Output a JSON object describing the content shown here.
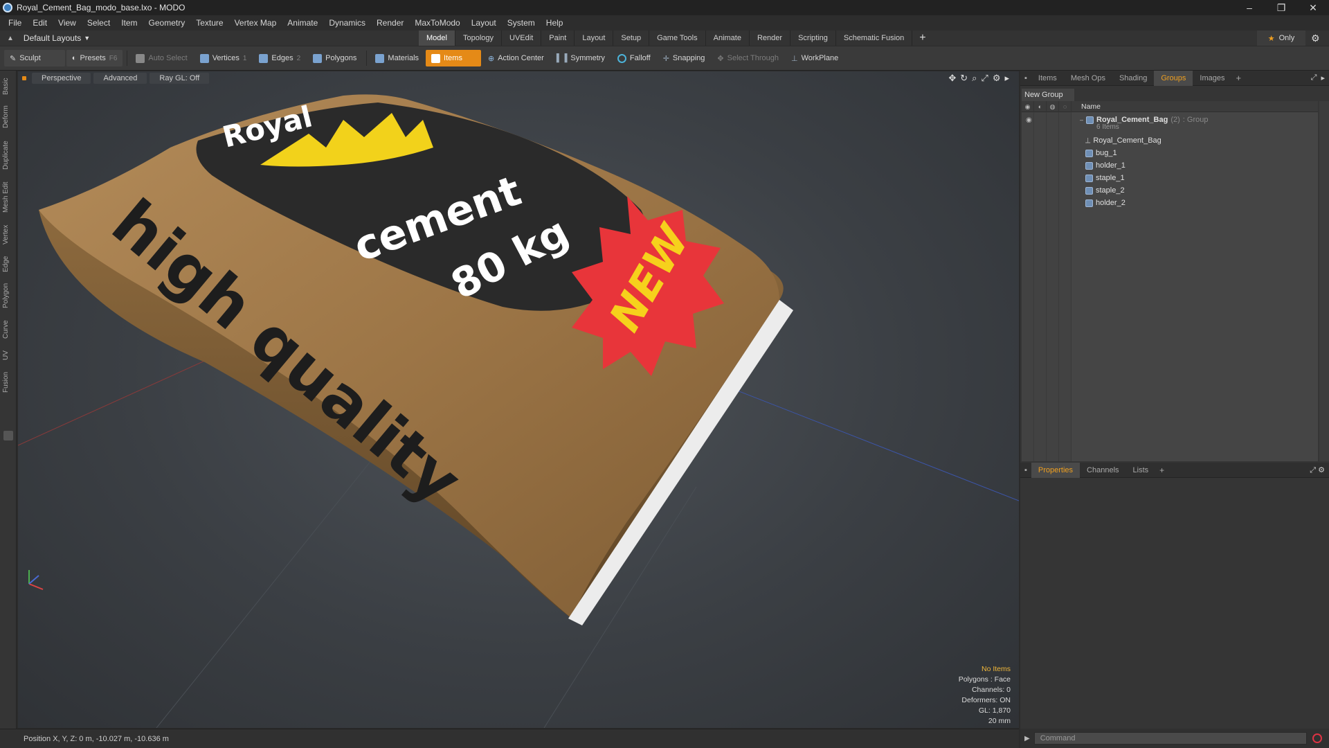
{
  "window": {
    "title": "Royal_Cement_Bag_modo_base.lxo - MODO",
    "minimize": "–",
    "restore": "❐",
    "close": "✕"
  },
  "menu": [
    "File",
    "Edit",
    "View",
    "Select",
    "Item",
    "Geometry",
    "Texture",
    "Vertex Map",
    "Animate",
    "Dynamics",
    "Render",
    "MaxToModo",
    "Layout",
    "System",
    "Help"
  ],
  "layoutbar": {
    "layout": "Default Layouts",
    "tabs": [
      "Model",
      "Topology",
      "UVEdit",
      "Paint",
      "Layout",
      "Setup",
      "Game Tools",
      "Animate",
      "Render",
      "Scripting",
      "Schematic Fusion"
    ],
    "active_tab": "Model",
    "add": "+",
    "only": "Only"
  },
  "toolbar": {
    "sculpt": "Sculpt",
    "presets": "Presets",
    "presets_key": "F6",
    "auto_select": "Auto Select",
    "vertices": "Vertices",
    "vertices_key": "1",
    "edges": "Edges",
    "edges_key": "2",
    "polygons": "Polygons",
    "materials": "Materials",
    "items": "Items",
    "action_center": "Action Center",
    "symmetry": "Symmetry",
    "falloff": "Falloff",
    "snapping": "Snapping",
    "select_through": "Select Through",
    "workplane": "WorkPlane"
  },
  "left_tabs": [
    "Basic",
    "Deform",
    "Duplicate",
    "Mesh Edit",
    "Vertex",
    "Edge",
    "Polygon",
    "Curve",
    "UV",
    "Fusion"
  ],
  "viewport": {
    "buttons": [
      "Perspective",
      "Advanced",
      "Ray GL: Off"
    ],
    "bag_text": {
      "brand_top": "Royal",
      "brand": "cement",
      "weight": "80 kg",
      "slogan": "high quality",
      "badge": "NEW"
    },
    "info": {
      "items": "No Items",
      "polygons": "Polygons : Face",
      "channels": "Channels: 0",
      "deformers": "Deformers: ON",
      "gl": "GL: 1,870",
      "scale": "20 mm"
    }
  },
  "statusbar": {
    "position": "Position X, Y, Z:  0 m, -10.027 m, -10.636 m"
  },
  "right_panel": {
    "tabs": [
      "Items",
      "Mesh Ops",
      "Shading",
      "Groups",
      "Images"
    ],
    "active_tab": "Groups",
    "new_group": "New Group",
    "column_name": "Name",
    "group": {
      "name": "Royal_Cement_Bag",
      "count": "(2)",
      "type": ": Group",
      "subtitle": "6 Items"
    },
    "items": [
      "Royal_Cement_Bag",
      "bug_1",
      "holder_1",
      "staple_1",
      "staple_2",
      "holder_2"
    ],
    "props_tabs": [
      "Properties",
      "Channels",
      "Lists"
    ],
    "props_active": "Properties",
    "command_placeholder": "Command"
  },
  "colors": {
    "accent": "#e58a17",
    "bag": "#a07848",
    "badge": "#e8353a",
    "crown": "#f2d21b"
  }
}
